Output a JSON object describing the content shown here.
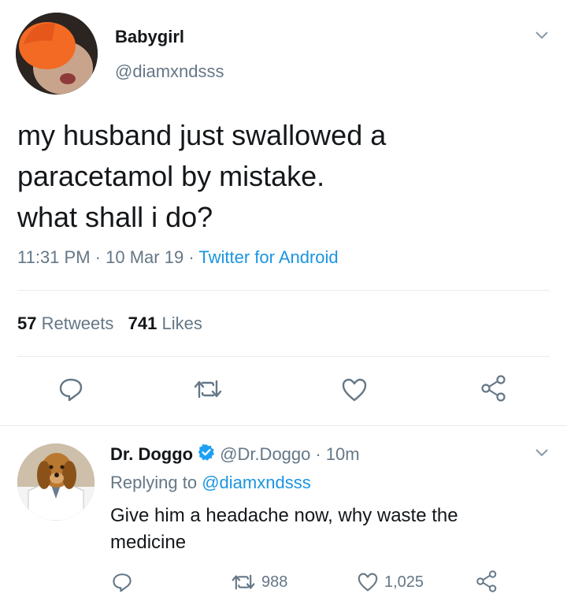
{
  "tweet": {
    "display_name": "Babygirl",
    "handle": "@diamxndsss",
    "text_lines": [
      "my husband just swallowed a",
      "paracetamol by mistake.",
      "what shall i do?"
    ],
    "time": "11:31 PM",
    "date": "10 Mar 19",
    "separator": "·",
    "source": "Twitter for Android",
    "retweets_count": "57",
    "retweets_label": "Retweets",
    "likes_count": "741",
    "likes_label": "Likes"
  },
  "reply": {
    "display_name": "Dr. Doggo",
    "handle": "@Dr.Doggo",
    "separator": "·",
    "age": "10m",
    "replying_to_label": "Replying to",
    "replying_to_handle": "@diamxndsss",
    "text": "Give him a headache now, why waste the medicine",
    "retweet_count": "988",
    "like_count": "1,025"
  },
  "icons": {
    "reply": "reply-icon",
    "retweet": "retweet-icon",
    "like": "heart-icon",
    "share": "share-icon",
    "menu": "chevron-down-icon",
    "verified": "verified-badge-icon"
  },
  "colors": {
    "text": "#14171a",
    "secondary": "#657786",
    "link": "#1b95e0",
    "divider": "#e6ecf0"
  }
}
